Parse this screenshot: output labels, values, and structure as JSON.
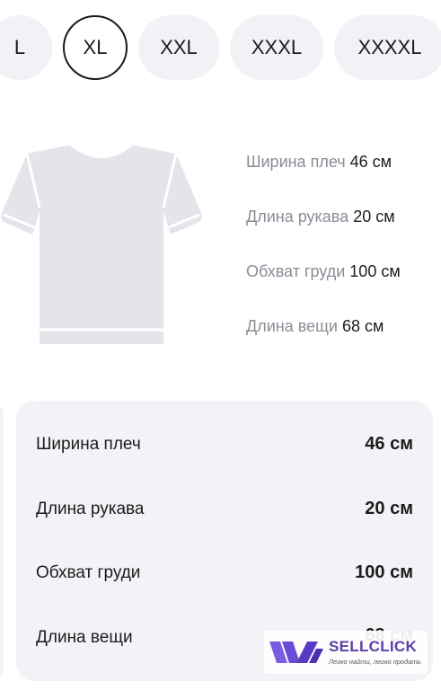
{
  "sizes": [
    {
      "label": "L",
      "selected": false
    },
    {
      "label": "XL",
      "selected": true
    },
    {
      "label": "XXL",
      "selected": false
    },
    {
      "label": "XXXL",
      "selected": false
    },
    {
      "label": "XXXXL",
      "selected": false
    }
  ],
  "specs": [
    {
      "label": "Ширина плеч",
      "value": "46 см"
    },
    {
      "label": "Длина рукава",
      "value": "20 см"
    },
    {
      "label": "Обхват груди",
      "value": "100 см"
    },
    {
      "label": "Длина вещи",
      "value": "68 см"
    }
  ],
  "table": [
    {
      "label": "Ширина плеч",
      "value": "46 см"
    },
    {
      "label": "Длина рукава",
      "value": "20 см"
    },
    {
      "label": "Обхват груди",
      "value": "100 см"
    },
    {
      "label": "Длина вещи",
      "value": "68 см"
    }
  ],
  "watermark": {
    "name": "SELLCLICK",
    "tagline": "Легко найти, легко продать"
  },
  "colors": {
    "chip_bg": "#f1f2f6",
    "card_bg": "#f2f3f7",
    "muted_text": "#8a8d96",
    "brand": "#5b3fa8"
  }
}
